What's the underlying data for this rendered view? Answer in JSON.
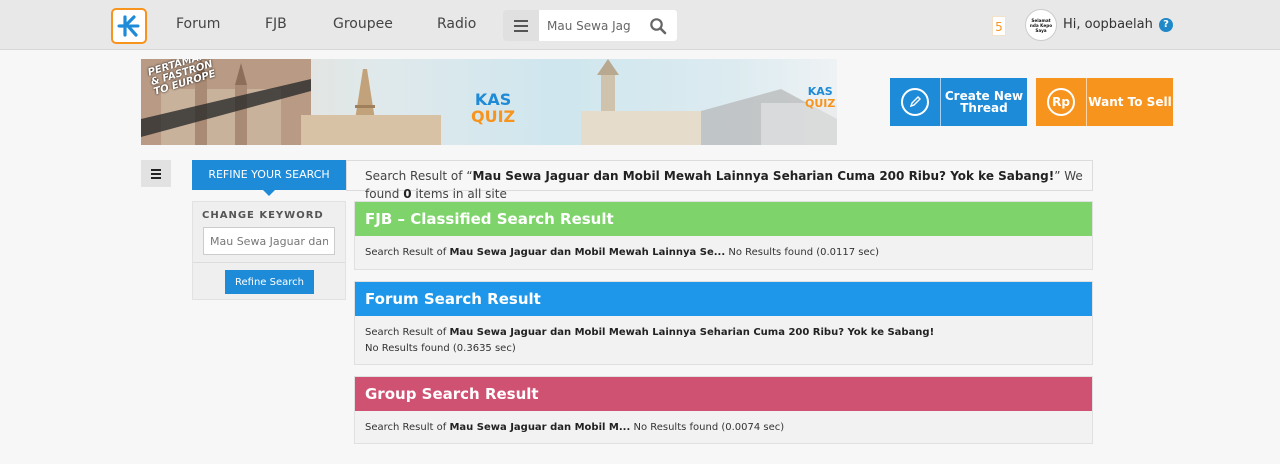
{
  "header": {
    "logo_alt": "K",
    "nav": [
      "Forum",
      "FJB",
      "Groupee",
      "Radio"
    ],
    "search": {
      "value": "Mau Sewa Jag",
      "placeholder": ""
    },
    "notification_count": "5",
    "avatar_text": [
      "Selamat",
      "nda Kepo",
      "Saya"
    ],
    "greeting": "Hi, oopbaelah",
    "help_glyph": "?"
  },
  "banner": {
    "promo_lines": [
      "PERTAMAX",
      "& FASTRON",
      "TO EUROPE"
    ],
    "quiz_top": "KAS",
    "quiz_bottom": "QUIZ"
  },
  "actions": {
    "create_thread": "Create New Thread",
    "want_to_sell": "Want To Sell",
    "sell_icon_text": "Rp"
  },
  "refine": {
    "tab_label": "REFINE YOUR SEARCH",
    "keyword_label": "CHANGE KEYWORD",
    "keyword_value": "Mau Sewa Jaguar dan",
    "button_label": "Refine Search"
  },
  "summary": {
    "prefix": "Search Result of “",
    "query": "Mau Sewa Jaguar dan Mobil Mewah Lainnya Seharian Cuma 200 Ribu? Yok ke Sabang!",
    "middle": "” We found ",
    "count": "0",
    "suffix": " items in all site"
  },
  "results": {
    "fjb": {
      "title": "FJB – Classified Search Result",
      "prefix": "Search Result of ",
      "query": "Mau Sewa Jaguar dan Mobil Mewah Lainnya Se...",
      "status": " No Results found (0.0117 sec)"
    },
    "forum": {
      "title": "Forum Search Result",
      "prefix": "Search Result of ",
      "query": "Mau Sewa Jaguar dan Mobil Mewah Lainnya Seharian Cuma 200 Ribu? Yok ke Sabang!",
      "status": " No Results found (0.3635 sec)"
    },
    "group": {
      "title": "Group Search Result",
      "prefix": "Search Result of ",
      "query": "Mau Sewa Jaguar dan Mobil M...",
      "status": " No Results found (0.0074 sec)"
    }
  },
  "colors": {
    "accent_blue": "#1e8bd9",
    "accent_orange": "#f7941e",
    "fjb_green": "#7ed46a",
    "forum_blue": "#1e97ea",
    "group_pink": "#d05273"
  },
  "icons": [
    "kaskus-logo-icon",
    "menu-icon",
    "search-icon",
    "help-icon",
    "pencil-icon",
    "rupiah-icon",
    "sidebar-menu-icon"
  ]
}
